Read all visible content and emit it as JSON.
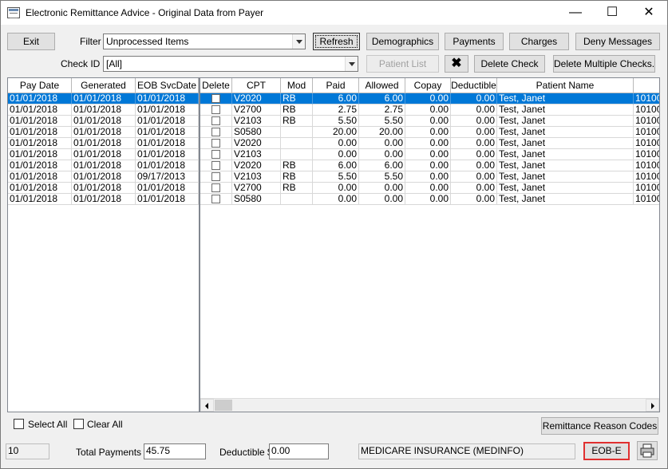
{
  "window": {
    "title": "Electronic Remittance Advice - Original Data from Payer"
  },
  "toolbar": {
    "exit_label": "Exit",
    "filter_label": "Filter",
    "filter_value": "Unprocessed Items",
    "checkid_label": "Check ID",
    "checkid_value": "[All]",
    "refresh_label": "Refresh",
    "demographics_label": "Demographics",
    "payments_label": "Payments",
    "charges_label": "Charges",
    "deny_label": "Deny Messages",
    "patient_list_label": "Patient List",
    "delete_icon": "x-icon",
    "delete_check_label": "Delete Check",
    "delete_multiple_label": "Delete Multiple Checks..."
  },
  "left_grid": {
    "headers": [
      "Pay Date",
      "Generated",
      "EOB SvcDate"
    ],
    "rows": [
      [
        "01/01/2018",
        "01/01/2018",
        "01/01/2018"
      ],
      [
        "01/01/2018",
        "01/01/2018",
        "01/01/2018"
      ],
      [
        "01/01/2018",
        "01/01/2018",
        "01/01/2018"
      ],
      [
        "01/01/2018",
        "01/01/2018",
        "01/01/2018"
      ],
      [
        "01/01/2018",
        "01/01/2018",
        "01/01/2018"
      ],
      [
        "01/01/2018",
        "01/01/2018",
        "01/01/2018"
      ],
      [
        "01/01/2018",
        "01/01/2018",
        "01/01/2018"
      ],
      [
        "01/01/2018",
        "01/01/2018",
        "09/17/2013"
      ],
      [
        "01/01/2018",
        "01/01/2018",
        "01/01/2018"
      ],
      [
        "01/01/2018",
        "01/01/2018",
        "01/01/2018"
      ]
    ]
  },
  "right_grid": {
    "headers": [
      "Delete",
      "CPT",
      "Mod",
      "Paid",
      "Allowed",
      "Copay",
      "Deductible",
      "Patient Name",
      ""
    ],
    "rows": [
      [
        "V2020",
        "RB",
        "6.00",
        "6.00",
        "0.00",
        "0.00",
        "Test, Janet",
        "10100"
      ],
      [
        "V2700",
        "RB",
        "2.75",
        "2.75",
        "0.00",
        "0.00",
        "Test, Janet",
        "10100"
      ],
      [
        "V2103",
        "RB",
        "5.50",
        "5.50",
        "0.00",
        "0.00",
        "Test, Janet",
        "10100"
      ],
      [
        "S0580",
        "",
        "20.00",
        "20.00",
        "0.00",
        "0.00",
        "Test, Janet",
        "10100"
      ],
      [
        "V2020",
        "",
        "0.00",
        "0.00",
        "0.00",
        "0.00",
        "Test, Janet",
        "10100"
      ],
      [
        "V2103",
        "",
        "0.00",
        "0.00",
        "0.00",
        "0.00",
        "Test, Janet",
        "10100"
      ],
      [
        "V2020",
        "RB",
        "6.00",
        "6.00",
        "0.00",
        "0.00",
        "Test, Janet",
        "10100"
      ],
      [
        "V2103",
        "RB",
        "5.50",
        "5.50",
        "0.00",
        "0.00",
        "Test, Janet",
        "10100"
      ],
      [
        "V2700",
        "RB",
        "0.00",
        "0.00",
        "0.00",
        "0.00",
        "Test, Janet",
        "10100"
      ],
      [
        "S0580",
        "",
        "0.00",
        "0.00",
        "0.00",
        "0.00",
        "Test, Janet",
        "10100"
      ]
    ]
  },
  "bottom": {
    "select_all_label": "Select All",
    "clear_all_label": "Clear All",
    "reason_codes_label": "Remittance Reason Codes",
    "count_value": "10",
    "total_payments_label": "Total Payments $",
    "total_payments_value": "45.75",
    "deductible_label": "Deductible $",
    "deductible_value": "0.00",
    "payer_value": "MEDICARE INSURANCE (MEDINFO)",
    "eob_label": "EOB-E",
    "eob_border_color": "#e03030",
    "print_icon": "printer-icon"
  },
  "selection": {
    "selected_row": 0,
    "highlight_color": "#0078d7"
  }
}
